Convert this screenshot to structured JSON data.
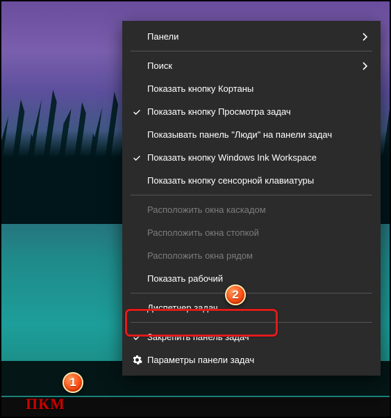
{
  "annotations": {
    "pkm": "ПКМ",
    "badge1": "1",
    "badge2": "2"
  },
  "menu": {
    "items": [
      {
        "label": "Панели",
        "submenu": true
      },
      {
        "sep": true
      },
      {
        "label": "Поиск",
        "submenu": true
      },
      {
        "label": "Показать кнопку Кортаны"
      },
      {
        "label": "Показать кнопку Просмотра задач",
        "checked": true
      },
      {
        "label": "Показывать панель \"Люди\" на панели задач"
      },
      {
        "label": "Показать кнопку Windows Ink Workspace",
        "checked": true
      },
      {
        "label": "Показать кнопку сенсорной клавиатуры"
      },
      {
        "sep": true
      },
      {
        "label": "Расположить окна каскадом",
        "disabled": true
      },
      {
        "label": "Расположить окна стопкой",
        "disabled": true
      },
      {
        "label": "Расположить окна рядом",
        "disabled": true
      },
      {
        "label": "Показать рабочий"
      },
      {
        "sep": true
      },
      {
        "label": "Диспетчер задач"
      },
      {
        "sep": true
      },
      {
        "label": "Закрепить панель задач",
        "checked": true
      },
      {
        "label": "Параметры панели задач",
        "gear": true
      }
    ]
  }
}
